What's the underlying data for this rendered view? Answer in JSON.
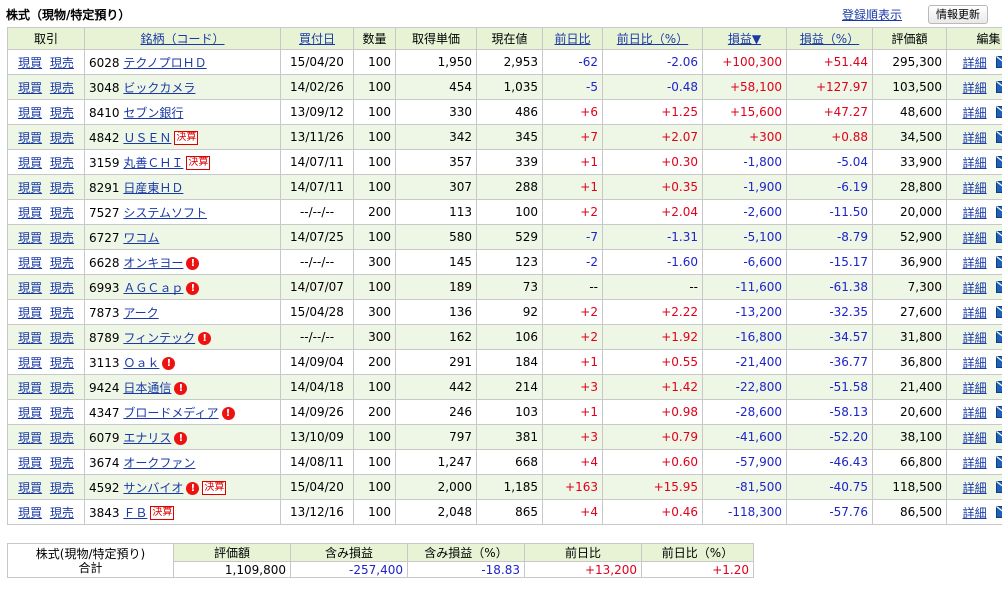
{
  "header": {
    "title": "株式（現物/特定預り）",
    "sort_link": "登録順表示",
    "refresh_button": "情報更新"
  },
  "columns": {
    "trade": "取引",
    "name": "銘柄（コード）",
    "buy_date": "買付日",
    "qty": "数量",
    "cost": "取得単価",
    "price": "現在値",
    "day_change": "前日比",
    "day_change_pct": "前日比（%）",
    "pl": "損益▼",
    "pl_pct": "損益（%）",
    "value": "評価額",
    "edit": "編集"
  },
  "actions": {
    "buy": "現買",
    "sell": "現売",
    "detail": "詳細"
  },
  "rows": [
    {
      "code": "6028",
      "name": "テクノプロＨＤ",
      "date": "15/04/20",
      "qty": "100",
      "cost": "1,950",
      "price": "2,953",
      "chg": "-62",
      "chg_pct": "-2.06",
      "pl": "+100,300",
      "pl_pct": "+51.44",
      "value": "295,300"
    },
    {
      "code": "3048",
      "name": "ビックカメラ",
      "date": "14/02/26",
      "qty": "100",
      "cost": "454",
      "price": "1,035",
      "chg": "-5",
      "chg_pct": "-0.48",
      "pl": "+58,100",
      "pl_pct": "+127.97",
      "value": "103,500"
    },
    {
      "code": "8410",
      "name": "セブン銀行",
      "date": "13/09/12",
      "qty": "100",
      "cost": "330",
      "price": "486",
      "chg": "+6",
      "chg_pct": "+1.25",
      "pl": "+15,600",
      "pl_pct": "+47.27",
      "value": "48,600"
    },
    {
      "code": "4842",
      "name": "ＵＳＥＮ",
      "tag": "決算",
      "date": "13/11/26",
      "qty": "100",
      "cost": "342",
      "price": "345",
      "chg": "+7",
      "chg_pct": "+2.07",
      "pl": "+300",
      "pl_pct": "+0.88",
      "value": "34,500"
    },
    {
      "code": "3159",
      "name": "丸善ＣＨＩ",
      "tag": "決算",
      "date": "14/07/11",
      "qty": "100",
      "cost": "357",
      "price": "339",
      "chg": "+1",
      "chg_pct": "+0.30",
      "pl": "-1,800",
      "pl_pct": "-5.04",
      "value": "33,900"
    },
    {
      "code": "8291",
      "name": "日産東ＨＤ",
      "date": "14/07/11",
      "qty": "100",
      "cost": "307",
      "price": "288",
      "chg": "+1",
      "chg_pct": "+0.35",
      "pl": "-1,900",
      "pl_pct": "-6.19",
      "value": "28,800"
    },
    {
      "code": "7527",
      "name": "システムソフト",
      "date": "--/--/--",
      "qty": "200",
      "cost": "113",
      "price": "100",
      "chg": "+2",
      "chg_pct": "+2.04",
      "pl": "-2,600",
      "pl_pct": "-11.50",
      "value": "20,000"
    },
    {
      "code": "6727",
      "name": "ワコム",
      "date": "14/07/25",
      "qty": "100",
      "cost": "580",
      "price": "529",
      "chg": "-7",
      "chg_pct": "-1.31",
      "pl": "-5,100",
      "pl_pct": "-8.79",
      "value": "52,900"
    },
    {
      "code": "6628",
      "name": "オンキヨー",
      "alert": true,
      "date": "--/--/--",
      "qty": "300",
      "cost": "145",
      "price": "123",
      "chg": "-2",
      "chg_pct": "-1.60",
      "pl": "-6,600",
      "pl_pct": "-15.17",
      "value": "36,900"
    },
    {
      "code": "6993",
      "name": "ＡＧＣａｐ",
      "alert": true,
      "date": "14/07/07",
      "qty": "100",
      "cost": "189",
      "price": "73",
      "chg": "--",
      "chg_pct": "--",
      "pl": "-11,600",
      "pl_pct": "-61.38",
      "value": "7,300"
    },
    {
      "code": "7873",
      "name": "アーク",
      "date": "15/04/28",
      "qty": "300",
      "cost": "136",
      "price": "92",
      "chg": "+2",
      "chg_pct": "+2.22",
      "pl": "-13,200",
      "pl_pct": "-32.35",
      "value": "27,600"
    },
    {
      "code": "8789",
      "name": "フィンテック",
      "alert": true,
      "date": "--/--/--",
      "qty": "300",
      "cost": "162",
      "price": "106",
      "chg": "+2",
      "chg_pct": "+1.92",
      "pl": "-16,800",
      "pl_pct": "-34.57",
      "value": "31,800"
    },
    {
      "code": "3113",
      "name": "Ｏａｋ",
      "alert": true,
      "date": "14/09/04",
      "qty": "200",
      "cost": "291",
      "price": "184",
      "chg": "+1",
      "chg_pct": "+0.55",
      "pl": "-21,400",
      "pl_pct": "-36.77",
      "value": "36,800"
    },
    {
      "code": "9424",
      "name": "日本通信",
      "alert": true,
      "date": "14/04/18",
      "qty": "100",
      "cost": "442",
      "price": "214",
      "chg": "+3",
      "chg_pct": "+1.42",
      "pl": "-22,800",
      "pl_pct": "-51.58",
      "value": "21,400"
    },
    {
      "code": "4347",
      "name": "ブロードメディア",
      "alert": true,
      "date": "14/09/26",
      "qty": "200",
      "cost": "246",
      "price": "103",
      "chg": "+1",
      "chg_pct": "+0.98",
      "pl": "-28,600",
      "pl_pct": "-58.13",
      "value": "20,600"
    },
    {
      "code": "6079",
      "name": "エナリス",
      "alert": true,
      "date": "13/10/09",
      "qty": "100",
      "cost": "797",
      "price": "381",
      "chg": "+3",
      "chg_pct": "+0.79",
      "pl": "-41,600",
      "pl_pct": "-52.20",
      "value": "38,100"
    },
    {
      "code": "3674",
      "name": "オークファン",
      "date": "14/08/11",
      "qty": "100",
      "cost": "1,247",
      "price": "668",
      "chg": "+4",
      "chg_pct": "+0.60",
      "pl": "-57,900",
      "pl_pct": "-46.43",
      "value": "66,800"
    },
    {
      "code": "4592",
      "name": "サンバイオ",
      "alert": true,
      "tag": "決算",
      "date": "15/04/20",
      "qty": "100",
      "cost": "2,000",
      "price": "1,185",
      "chg": "+163",
      "chg_pct": "+15.95",
      "pl": "-81,500",
      "pl_pct": "-40.75",
      "value": "118,500"
    },
    {
      "code": "3843",
      "name": "ＦＢ",
      "tag": "決算",
      "date": "13/12/16",
      "qty": "100",
      "cost": "2,048",
      "price": "865",
      "chg": "+4",
      "chg_pct": "+0.46",
      "pl": "-118,300",
      "pl_pct": "-57.76",
      "value": "86,500"
    }
  ],
  "summary": {
    "label_line1": "株式(現物/特定預り)",
    "label_line2": "合計",
    "headers": [
      "評価額",
      "含み損益",
      "含み損益（%）",
      "前日比",
      "前日比（%）"
    ],
    "values": [
      "1,109,800",
      "-257,400",
      "-18.83",
      "+13,200",
      "+1.20"
    ]
  },
  "colors": {
    "header_bg": "#e8f3d6",
    "row_alt_bg": "#eef6e6",
    "positive": "#e0001b",
    "negative": "#1d24c8",
    "link": "#1a3aa8"
  },
  "icons": {
    "alert": "alert-icon",
    "mail": "mail-icon"
  }
}
